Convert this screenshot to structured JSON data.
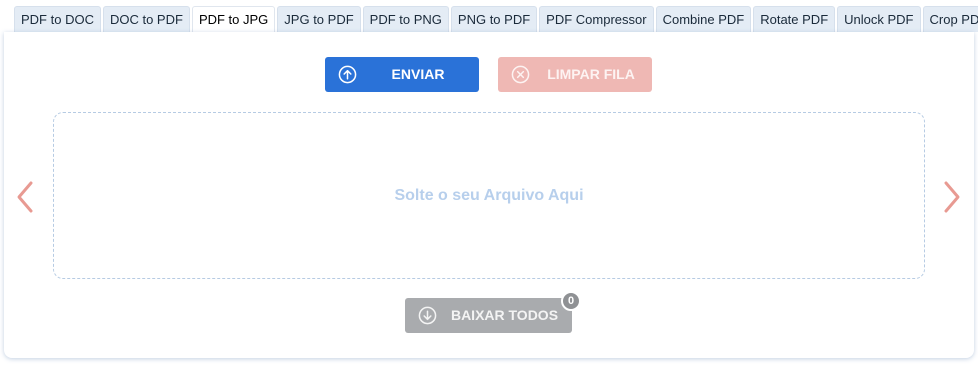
{
  "tabs": [
    {
      "label": "PDF to DOC"
    },
    {
      "label": "DOC to PDF"
    },
    {
      "label": "PDF to JPG",
      "active": true
    },
    {
      "label": "JPG to PDF"
    },
    {
      "label": "PDF to PNG"
    },
    {
      "label": "PNG to PDF"
    },
    {
      "label": "PDF Compressor"
    },
    {
      "label": "Combine PDF"
    },
    {
      "label": "Rotate PDF"
    },
    {
      "label": "Unlock PDF"
    },
    {
      "label": "Crop PDF"
    }
  ],
  "toolbar": {
    "send_label": "ENVIAR",
    "clear_label": "LIMPAR FILA"
  },
  "dropzone": {
    "text": "Solte o seu Arquivo Aqui"
  },
  "download": {
    "label": "BAIXAR TODOS",
    "count": "0"
  },
  "icons": {
    "send": "upload-circle-icon",
    "clear": "close-circle-icon",
    "download": "download-circle-icon",
    "prev": "chevron-left-icon",
    "next": "chevron-right-icon"
  },
  "colors": {
    "primary": "#2a72d8",
    "clear": "#efb8b4",
    "disabled": "#a9abae",
    "arrow": "#e89a92",
    "drop_text": "#b7cfec"
  }
}
